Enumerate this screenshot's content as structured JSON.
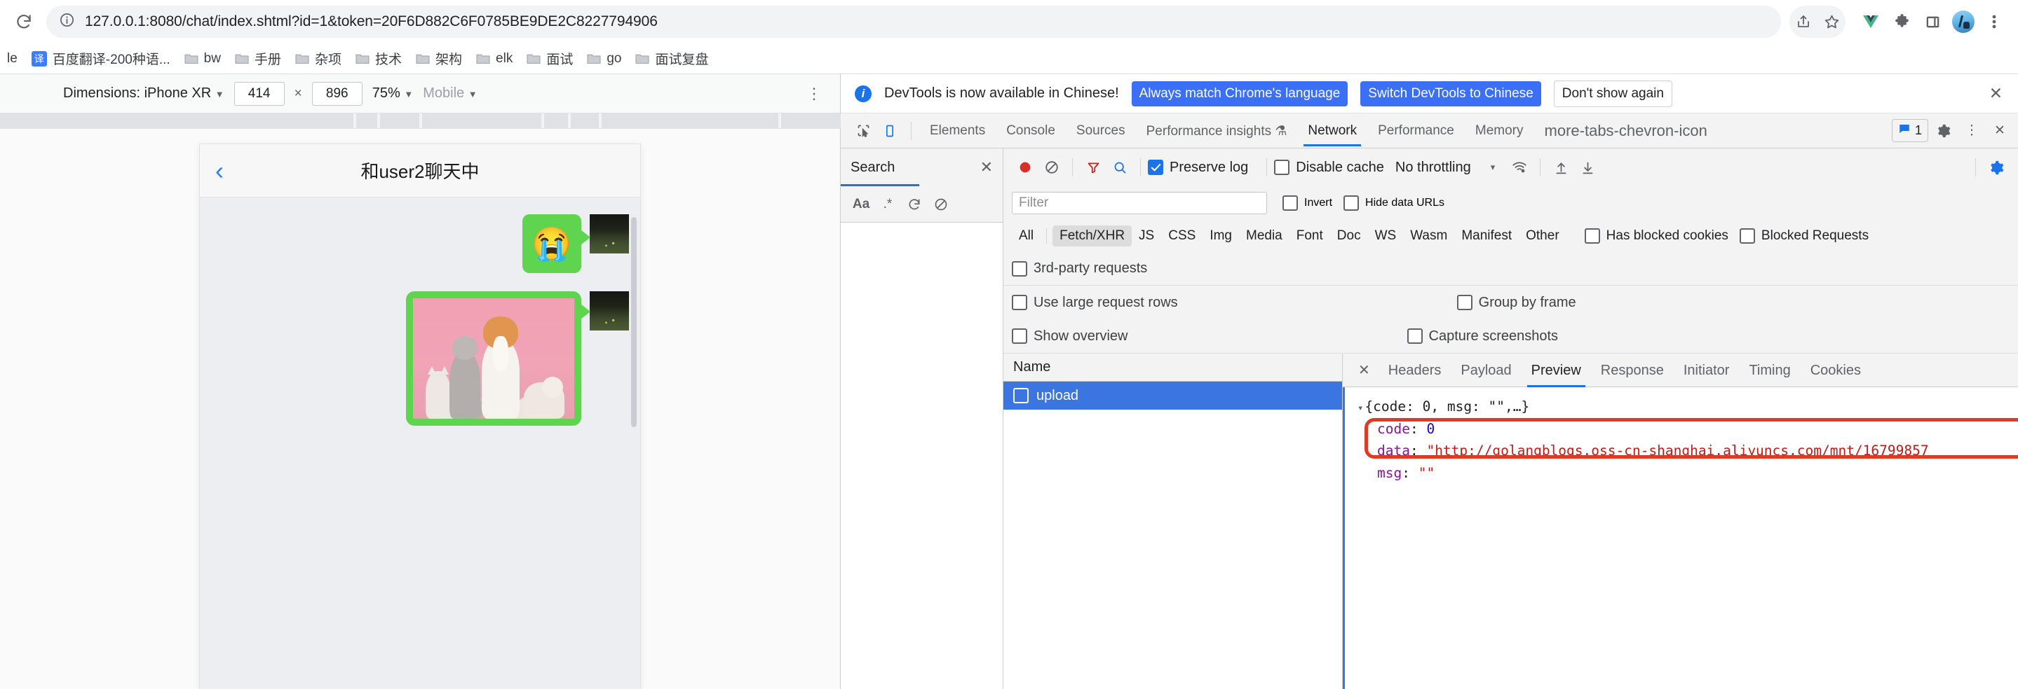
{
  "browser": {
    "reload_icon": "reload-icon",
    "site_info_icon": "info-circle-icon",
    "url": "127.0.0.1:8080/chat/index.shtml?id=1&token=20F6D882C6F0785BE9DE2C8227794906",
    "toolbar_icons": [
      {
        "name": "share-icon"
      },
      {
        "name": "bookmark-star-icon"
      },
      {
        "name": "vue-devtools-icon"
      },
      {
        "name": "extensions-puzzle-icon"
      },
      {
        "name": "side-panel-icon"
      },
      {
        "name": "profile-avatar"
      },
      {
        "name": "chrome-menu-kebab-icon"
      }
    ]
  },
  "bookmarks": {
    "truncated_first": "le",
    "items": [
      {
        "label": "百度翻译-200种语...",
        "icon": "translate-favicon"
      },
      {
        "label": "bw",
        "icon": "folder-icon"
      },
      {
        "label": "手册",
        "icon": "folder-icon"
      },
      {
        "label": "杂项",
        "icon": "folder-icon"
      },
      {
        "label": "技术",
        "icon": "folder-icon"
      },
      {
        "label": "架构",
        "icon": "folder-icon"
      },
      {
        "label": "elk",
        "icon": "folder-icon"
      },
      {
        "label": "面试",
        "icon": "folder-icon"
      },
      {
        "label": "go",
        "icon": "folder-icon"
      },
      {
        "label": "面试复盘",
        "icon": "folder-icon"
      }
    ]
  },
  "device_toolbar": {
    "dimensions_label": "Dimensions: iPhone XR",
    "width": "414",
    "height": "896",
    "x_symbol": "×",
    "zoom": "75%",
    "mode": "Mobile",
    "kebab_icon": "more-options-kebab-icon"
  },
  "phone": {
    "header": {
      "back_icon": "back-chevron-icon",
      "title": "和user2聊天中"
    },
    "messages": [
      {
        "type": "emoji",
        "content": "😭",
        "sender": "self",
        "avatar": "grass-photo-avatar"
      },
      {
        "type": "image",
        "content": "pets-on-pink-background-photo",
        "sender": "self",
        "avatar": "grass-photo-avatar"
      }
    ]
  },
  "devtools": {
    "banner": {
      "info_icon": "info-icon",
      "message": "DevTools is now available in Chinese!",
      "primary_button": "Always match Chrome's language",
      "secondary_button": "Switch DevTools to Chinese",
      "tertiary_button": "Don't show again",
      "close_icon": "close-icon"
    },
    "tabbar": {
      "inspect_icon": "inspect-element-icon",
      "device_toggle_icon": "device-toolbar-icon",
      "tabs": [
        {
          "label": "Elements",
          "active": false
        },
        {
          "label": "Console",
          "active": false
        },
        {
          "label": "Sources",
          "active": false
        },
        {
          "label": "Performance insights",
          "active": false,
          "badge_icon": "experiment-flask-icon"
        },
        {
          "label": "Network",
          "active": true
        },
        {
          "label": "Performance",
          "active": false
        },
        {
          "label": "Memory",
          "active": false
        }
      ],
      "more_icon": "more-tabs-chevron-icon",
      "issues_count": "1",
      "issues_icon": "issues-message-icon",
      "settings_icon": "gear-icon",
      "kebab_icon": "devtools-menu-kebab-icon",
      "close_icon": "close-devtools-icon"
    },
    "search_panel": {
      "title": "Search",
      "close_icon": "close-icon",
      "match_case_icon": "Aa",
      "regex_icon": ".*",
      "refresh_icon": "refresh-icon",
      "clear_icon": "clear-icon"
    },
    "network": {
      "record_icon": "record-red-circle-icon",
      "clear_icon": "clear-no-entry-icon",
      "filter_icon": "filter-funnel-icon",
      "search_icon": "search-magnifier-icon",
      "preserve_log": {
        "label": "Preserve log",
        "checked": true
      },
      "disable_cache": {
        "label": "Disable cache",
        "checked": false
      },
      "throttling": "No throttling",
      "throttling_caret": "▾",
      "wifi_icon": "network-conditions-wifi-icon",
      "import_icon": "import-har-up-arrow-icon",
      "export_icon": "export-har-down-arrow-icon",
      "settings_icon": "network-settings-gear-icon",
      "filter_placeholder": "Filter",
      "filter_value": "",
      "invert": {
        "label": "Invert",
        "checked": false
      },
      "hide_data_urls": {
        "label": "Hide data URLs",
        "checked": false
      },
      "types": [
        {
          "label": "All",
          "selected": false
        },
        {
          "label": "Fetch/XHR",
          "selected": true
        },
        {
          "label": "JS",
          "selected": false
        },
        {
          "label": "CSS",
          "selected": false
        },
        {
          "label": "Img",
          "selected": false
        },
        {
          "label": "Media",
          "selected": false
        },
        {
          "label": "Font",
          "selected": false
        },
        {
          "label": "Doc",
          "selected": false
        },
        {
          "label": "WS",
          "selected": false
        },
        {
          "label": "Wasm",
          "selected": false
        },
        {
          "label": "Manifest",
          "selected": false
        },
        {
          "label": "Other",
          "selected": false
        }
      ],
      "has_blocked_cookies": {
        "label": "Has blocked cookies",
        "checked": false
      },
      "blocked_requests": {
        "label": "Blocked Requests",
        "checked": false
      },
      "third_party": {
        "label": "3rd-party requests",
        "checked": false
      },
      "large_rows": {
        "label": "Use large request rows",
        "checked": false
      },
      "group_by_frame": {
        "label": "Group by frame",
        "checked": false
      },
      "show_overview": {
        "label": "Show overview",
        "checked": false
      },
      "capture_screenshots": {
        "label": "Capture screenshots",
        "checked": false
      },
      "column_header": "Name",
      "requests": [
        {
          "name": "upload",
          "selected": true
        }
      ]
    },
    "detail": {
      "close_icon": "close-detail-icon",
      "tabs": [
        {
          "label": "Headers",
          "active": false
        },
        {
          "label": "Payload",
          "active": false
        },
        {
          "label": "Preview",
          "active": true
        },
        {
          "label": "Response",
          "active": false
        },
        {
          "label": "Initiator",
          "active": false
        },
        {
          "label": "Timing",
          "active": false
        },
        {
          "label": "Cookies",
          "active": false
        }
      ],
      "preview": {
        "summary_triangle": "▾",
        "summary": "{code: 0, msg: \"\",…}",
        "rows": [
          {
            "key": "code",
            "sep": ": ",
            "value": "0",
            "kind": "num"
          },
          {
            "key": "data",
            "sep": ": ",
            "value": "\"http://golangblogs.oss-cn-shanghai.aliyuncs.com/mnt/16799857",
            "kind": "str",
            "highlighted": true
          },
          {
            "key": "msg",
            "sep": ": ",
            "value": "\"\"",
            "kind": "str"
          }
        ],
        "annotation_color": "#e03b22"
      }
    }
  }
}
